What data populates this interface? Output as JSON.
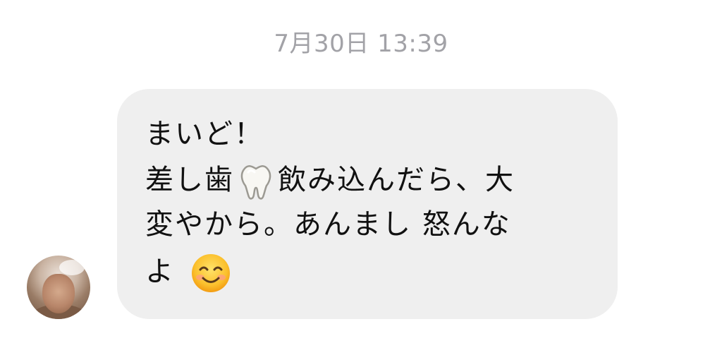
{
  "conversation": {
    "timestamp": "7月30日 13:39"
  },
  "message": {
    "line1": "まいど！",
    "line2_before_emoji": "差し歯",
    "line2_emoji_icon": "tooth-icon",
    "line2_after_emoji": "飲み込んだら、大",
    "line3": "変やから。あんまし 怒んな",
    "line4_text": "よ",
    "line4_emoji_icon": "smiling-face-icon"
  },
  "colors": {
    "bubble_background": "#efefef",
    "timestamp_text": "#a2a2a7",
    "message_text": "#111111"
  }
}
